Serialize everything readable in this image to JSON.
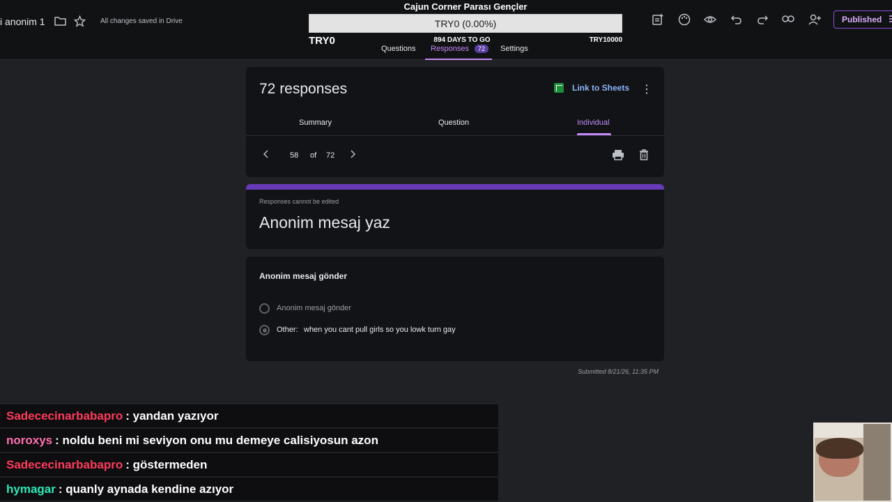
{
  "topbar": {
    "doc_title": "i anonim 1",
    "saved_status": "All changes saved in Drive",
    "publish_label": "Published"
  },
  "goal": {
    "title": "Cajun Corner Parası Gençler",
    "progress_text": "TRY0 (0.00%)",
    "progress_fraction": 0.0,
    "left_label": "TRY0",
    "days_to_go": "894 DAYS TO GO",
    "right_label": "TRY10000"
  },
  "tabs": {
    "questions": "Questions",
    "responses": "Responses",
    "responses_count": "72",
    "settings": "Settings"
  },
  "summary_card": {
    "count_title": "72 responses",
    "link_sheets": "Link to Sheets",
    "subtabs": [
      "Summary",
      "Question",
      "Individual"
    ],
    "pager_current": "58",
    "pager_of": "of",
    "pager_total": "72"
  },
  "form_header": {
    "note": "Responses cannot be edited",
    "title": "Anonim mesaj yaz"
  },
  "question": {
    "title": "Anonim mesaj gönder",
    "option_1": "Anonim mesaj gönder",
    "other_label": "Other:",
    "other_value": "when you cant pull girls so you lowk turn gay"
  },
  "submitted": "Submitted 8/21/26, 11:35 PM",
  "chat": [
    {
      "user": "Sadececinarbabapro",
      "message": ": yandan yazıyor",
      "color": "#ff3b5c"
    },
    {
      "user": "noroxys",
      "message": ": noldu beni mi seviyon onu mu demeye calisiyosun azon",
      "color": "#ff6fae"
    },
    {
      "user": "Sadececinarbabapro",
      "message": ": göstermeden",
      "color": "#ff3b5c"
    },
    {
      "user": "hymagar",
      "message": ": quanly aynada kendine azıyor",
      "color": "#2ee8b6"
    }
  ],
  "colors": {
    "accent": "#c58af9",
    "form_header": "#673ab7",
    "link": "#8ab4f8"
  }
}
